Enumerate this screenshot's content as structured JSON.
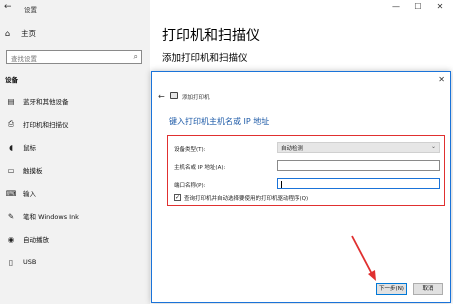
{
  "window": {
    "title": "设置",
    "back_glyph": "←",
    "minimize": "—",
    "maximize": "☐",
    "close": "✕"
  },
  "sidebar": {
    "home": "主页",
    "search_placeholder": "查找设置",
    "section": "设备",
    "items": [
      {
        "label": "蓝牙和其他设备",
        "icon": "bluetooth-icon",
        "glyph": "▤"
      },
      {
        "label": "打印机和扫描仪",
        "icon": "printer-icon",
        "glyph": "⎙"
      },
      {
        "label": "鼠标",
        "icon": "mouse-icon",
        "glyph": "◖"
      },
      {
        "label": "触摸板",
        "icon": "touchpad-icon",
        "glyph": "▭"
      },
      {
        "label": "输入",
        "icon": "keyboard-icon",
        "glyph": "⌨"
      },
      {
        "label": "笔和 Windows Ink",
        "icon": "pen-icon",
        "glyph": "✎"
      },
      {
        "label": "自动播放",
        "icon": "autoplay-icon",
        "glyph": "◉"
      },
      {
        "label": "USB",
        "icon": "usb-icon",
        "glyph": "▯"
      }
    ]
  },
  "main": {
    "title": "打印机和扫描仪",
    "subtitle": "添加打印机和扫描仪"
  },
  "dialog": {
    "close": "✕",
    "back": "←",
    "header": "添加打印机",
    "heading": "键入打印机主机名或 IP 地址",
    "device_type_label": "设备类型(T):",
    "device_type_value": "自动检测",
    "hostname_label": "主机名或 IP 地址(A):",
    "hostname_value": "",
    "port_label": "端口名称(P):",
    "port_value": "",
    "checkbox_checked": true,
    "checkbox_label": "查询打印机并自动选择要使用的打印机驱动程序(Q)",
    "next_button": "下一步(N)",
    "cancel_button": "取消"
  },
  "colors": {
    "accent": "#1a73d9",
    "highlight_red": "#e03030"
  }
}
